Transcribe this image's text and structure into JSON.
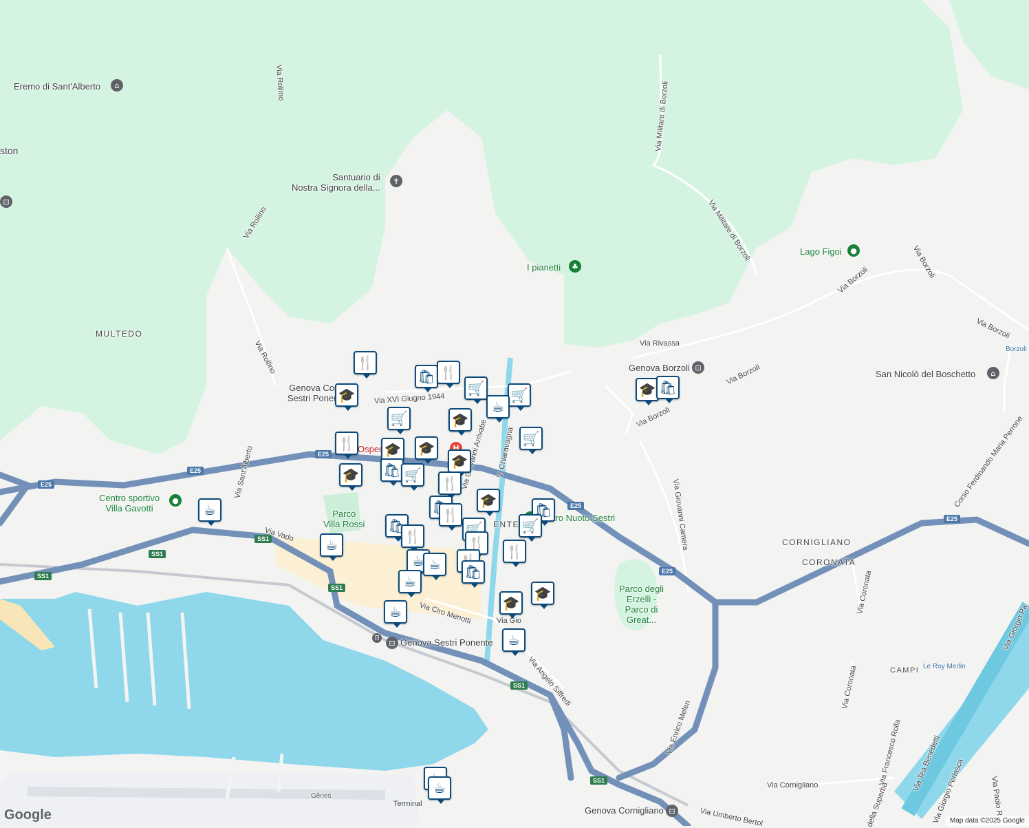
{
  "map": {
    "attribution": "Map data ©2025 Google",
    "logo": "Google",
    "colors": {
      "land": "#f3f3f2",
      "park": "#d4f4e1",
      "water": "#8fd8ec",
      "highway": "#7391b8",
      "pin_border": "#0b4a7a"
    }
  },
  "areas": {
    "multedo": "MULTEDO",
    "cornigliano": "CORNIGLIANO",
    "coronata": "CORONATA",
    "campi": "CAMPI",
    "ponente_partial": "ENTE",
    "aston_partial": "ston"
  },
  "places": {
    "eremo": "Eremo di Sant'Alberto",
    "santuario": "Santuario di\nNostra Signora della...",
    "pianetti": "I pianetti",
    "lago_figoi": "Lago Figoi",
    "san_nicolo": "San Nicolò del Boschetto",
    "borzoli_small": "Borzoli",
    "centro_sportivo": "Centro sportivo\nVilla Gavotti",
    "parco_villa_rossi": "Parco\nVilla Rossi",
    "parco_erzelli": "Parco degli\nErzelli -\nParco di\nGreat...",
    "centro_nuoto": "Centro Nuoto Sestri",
    "ospedale": "Ospedale",
    "le_roy_merlin": "Le Roy Merlin",
    "genes": "Gênes",
    "terminal": "Terminal"
  },
  "stations": {
    "sestri_ponente": "Genova Sestri Ponente",
    "cornigliano": "Genova Cornigliano",
    "borzoli": "Genova Borzoli",
    "costa_sestri": "Genova Costa\nSestri Ponente"
  },
  "streets": {
    "rollino_1": "Via Rollino",
    "rollino_2": "Via Rollino",
    "rollino_3": "Via Rollino",
    "militare_1": "Via Militare di Borzoli",
    "militare_2": "Via Militare di Borzoli",
    "borzoli_1": "Via Borzoli",
    "borzoli_2": "Via Borzoli",
    "borzoli_3": "Via Borzoli",
    "borzoli_4": "Via Borzoli",
    "borzoli_5": "Via Borzoli",
    "rivassa": "Via Rivassa",
    "xvi_giugno": "Via XVI Giugno 1944",
    "arrivabene": "Via Giovanni Arrivabe",
    "chiaravagna": "V. Chiaravagna",
    "sant_alberto": "Via Sant'Alberto",
    "vado": "Via Vado",
    "ciro_menotti": "Via Ciro Menotti",
    "angelo_siffredi": "Via Angelo Siffredi",
    "gio": "Via Gio",
    "giovanni_camera": "Via Giovanni Camera",
    "enrico_melen": "Via Enrico Melen",
    "coronata_1": "Via Coronata",
    "coronata_2": "Via Coronata",
    "cornigliano": "Via Cornigliano",
    "umberto_bertol": "Via Umberto Bertol",
    "ferdinando_perrone": "Corso Ferdinando Maria Perrone",
    "francesco_rolla": "Via Francesco Rolla",
    "della_superba": "della Superba",
    "tea_benedetti": "Via Tea Benedetti",
    "giorgio_perlasca": "Via Giorgio Perlasca",
    "giorgio_pa": "Via Giorgio Pa",
    "paolo_r": "Via Paolo R"
  },
  "shields": {
    "e25": "E25",
    "ss1": "SS1"
  },
  "marker_icons": {
    "restaurant": "restaurant-icon",
    "shopping": "shopping-bag-icon",
    "grocery": "shopping-cart-icon",
    "cafe": "coffee-cup-icon",
    "school": "graduation-cap-icon"
  }
}
